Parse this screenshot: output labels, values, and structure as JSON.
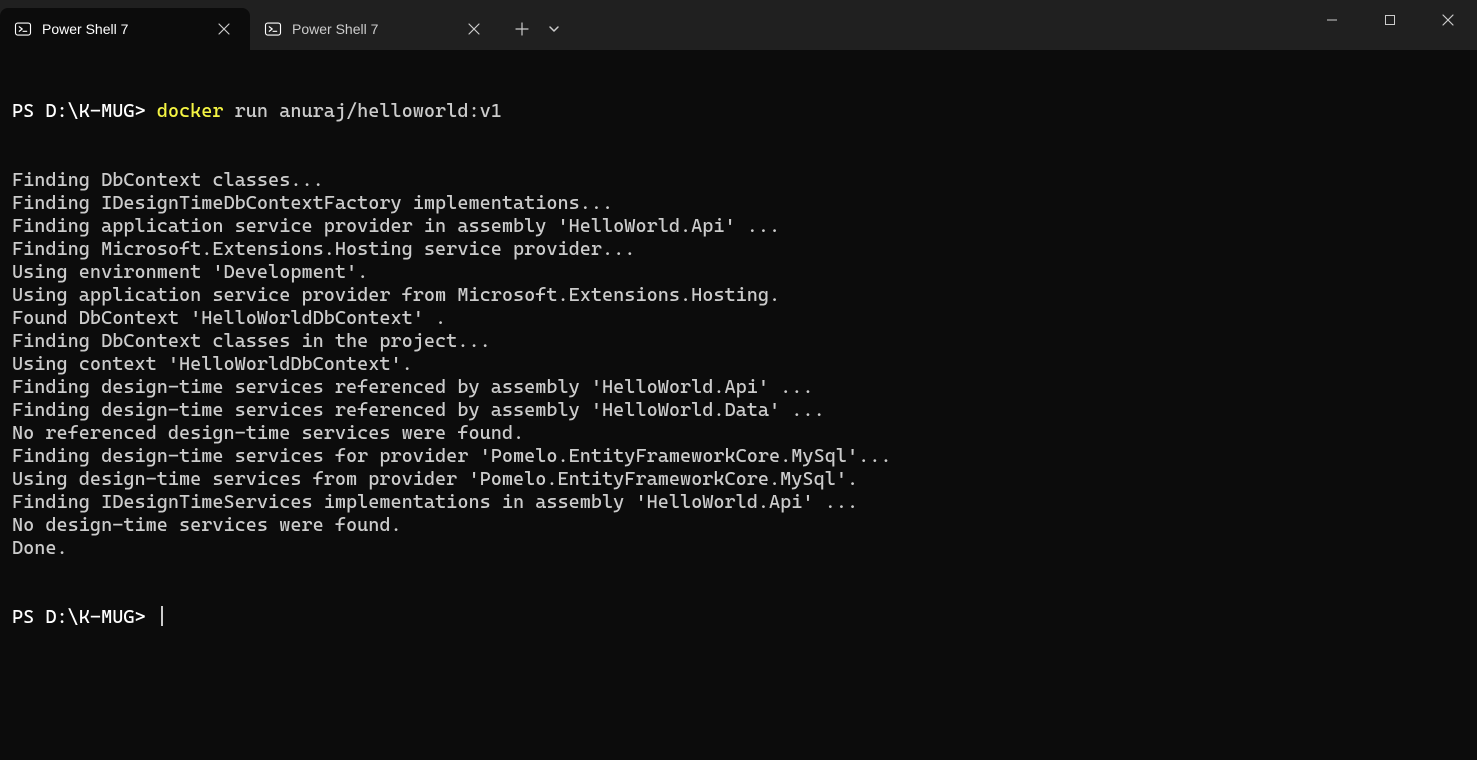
{
  "tabs": [
    {
      "title": "Power Shell 7",
      "active": true
    },
    {
      "title": "Power Shell 7",
      "active": false
    }
  ],
  "prompt1_path": "PS D:\\K-MUG> ",
  "command_highlight": "docker",
  "command_rest": " run anuraj/helloworld:v1",
  "output_lines": [
    "Finding DbContext classes...",
    "Finding IDesignTimeDbContextFactory implementations...",
    "Finding application service provider in assembly 'HelloWorld.Api' ...",
    "Finding Microsoft.Extensions.Hosting service provider...",
    "Using environment 'Development'.",
    "Using application service provider from Microsoft.Extensions.Hosting.",
    "Found DbContext 'HelloWorldDbContext' .",
    "Finding DbContext classes in the project...",
    "Using context 'HelloWorldDbContext'.",
    "Finding design-time services referenced by assembly 'HelloWorld.Api' ...",
    "Finding design-time services referenced by assembly 'HelloWorld.Data' ...",
    "No referenced design-time services were found.",
    "Finding design-time services for provider 'Pomelo.EntityFrameworkCore.MySql'...",
    "Using design-time services from provider 'Pomelo.EntityFrameworkCore.MySql'.",
    "Finding IDesignTimeServices implementations in assembly 'HelloWorld.Api' ...",
    "No design-time services were found.",
    "Done."
  ],
  "prompt2_path": "PS D:\\K-MUG> "
}
